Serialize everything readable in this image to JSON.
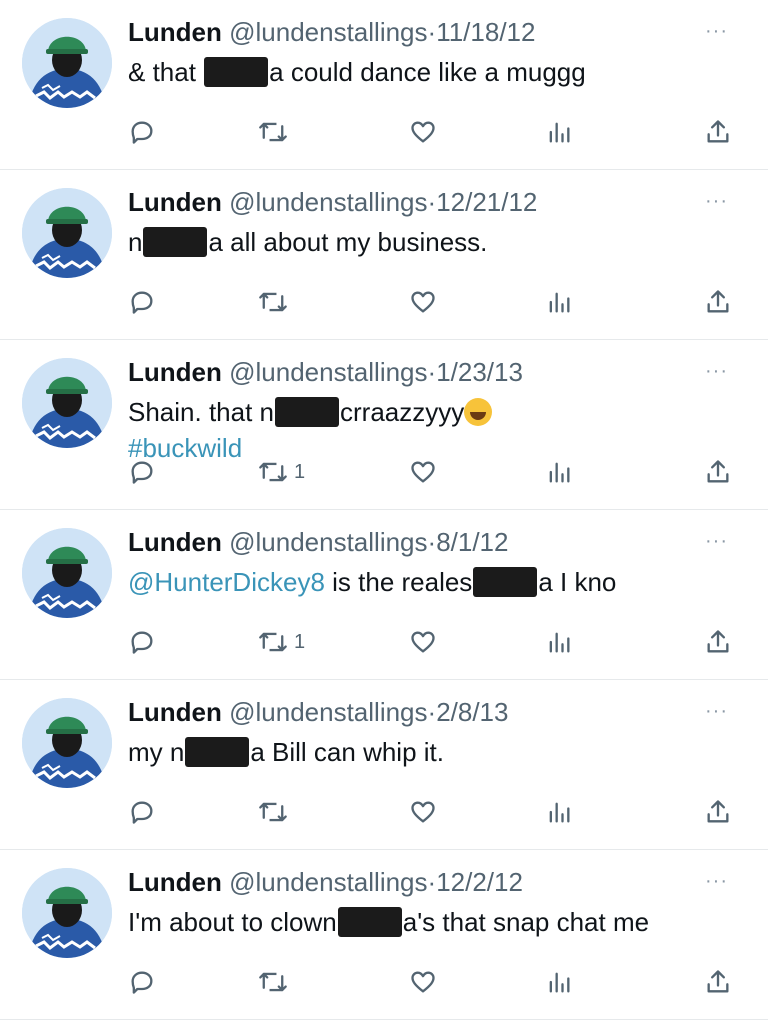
{
  "tweets": [
    {
      "name": "Lunden",
      "handle": "@lundenstallings",
      "sep": "·",
      "date": "11/18/12",
      "more": "···",
      "segments": [
        {
          "type": "text",
          "value": "& that "
        },
        {
          "type": "redact"
        },
        {
          "type": "text",
          "value": "a could dance like a muggg"
        }
      ],
      "retweets": ""
    },
    {
      "name": "Lunden",
      "handle": "@lundenstallings",
      "sep": "·",
      "date": "12/21/12",
      "more": "···",
      "segments": [
        {
          "type": "text",
          "value": "n"
        },
        {
          "type": "redact"
        },
        {
          "type": "text",
          "value": "a all about my business."
        }
      ],
      "retweets": ""
    },
    {
      "name": "Lunden",
      "handle": "@lundenstallings",
      "sep": "·",
      "date": "1/23/13",
      "more": "···",
      "segments": [
        {
          "type": "text",
          "value": "Shain. that n"
        },
        {
          "type": "redact"
        },
        {
          "type": "text",
          "value": "crraazzyyy"
        },
        {
          "type": "emoji",
          "name": "tears-of-joy-emoji"
        },
        {
          "type": "br"
        },
        {
          "type": "link",
          "value": "#buckwild"
        }
      ],
      "retweets": "1"
    },
    {
      "name": "Lunden",
      "handle": "@lundenstallings",
      "sep": "·",
      "date": "8/1/12",
      "more": "···",
      "segments": [
        {
          "type": "link",
          "value": "@HunterDickey8"
        },
        {
          "type": "text",
          "value": " is the reales"
        },
        {
          "type": "redact"
        },
        {
          "type": "text",
          "value": "a I kno"
        }
      ],
      "retweets": "1"
    },
    {
      "name": "Lunden",
      "handle": "@lundenstallings",
      "sep": "·",
      "date": "2/8/13",
      "more": "···",
      "segments": [
        {
          "type": "text",
          "value": "my n"
        },
        {
          "type": "redact"
        },
        {
          "type": "text",
          "value": "a Bill can whip it."
        }
      ],
      "retweets": ""
    },
    {
      "name": "Lunden",
      "handle": "@lundenstallings",
      "sep": "·",
      "date": "12/2/12",
      "more": "···",
      "segments": [
        {
          "type": "text",
          "value": "I'm about to clown"
        },
        {
          "type": "redact"
        },
        {
          "type": "text",
          "value": "a's that snap chat me"
        }
      ],
      "retweets": ""
    }
  ],
  "icons": {
    "reply": "reply-icon",
    "retweet": "retweet-icon",
    "like": "heart-icon",
    "views": "views-icon",
    "share": "share-icon"
  },
  "colors": {
    "text": "#0f1419",
    "muted": "#536471",
    "link": "#3a94b8",
    "divider": "#e6e9eb"
  }
}
